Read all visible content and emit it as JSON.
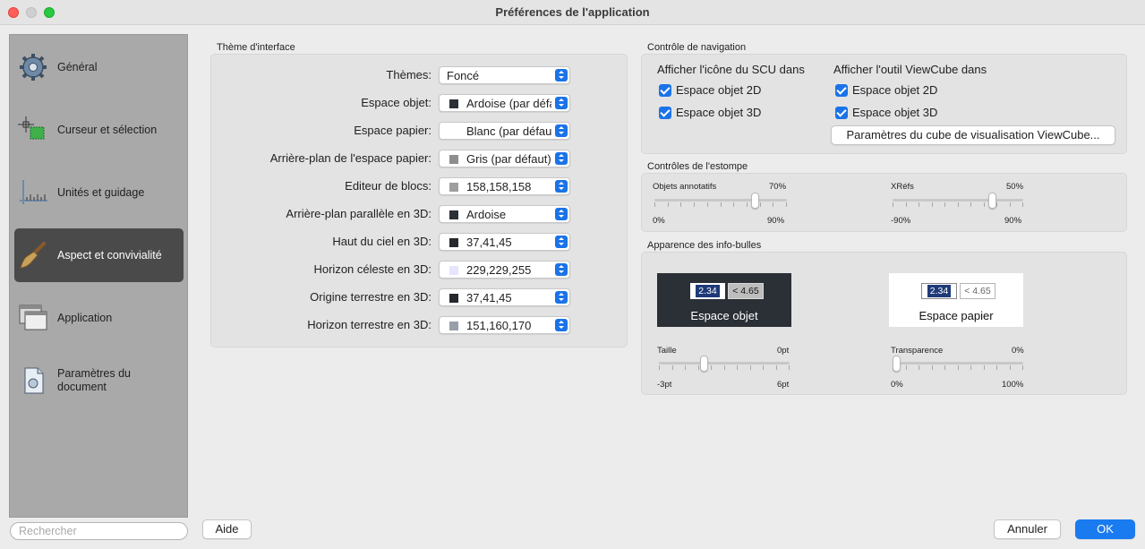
{
  "window": {
    "title": "Préférences de l'application"
  },
  "sidebar": {
    "items": [
      {
        "label": "Général",
        "icon": "gear-icon"
      },
      {
        "label": "Curseur et sélection",
        "icon": "crosshair-icon"
      },
      {
        "label": "Unités et guidage",
        "icon": "ruler-icon"
      },
      {
        "label": "Aspect et convivialité",
        "icon": "brush-icon",
        "active": true
      },
      {
        "label": "Application",
        "icon": "windows-icon"
      },
      {
        "label": "Paramètres du document",
        "icon": "document-icon"
      }
    ],
    "search_placeholder": "Rechercher"
  },
  "theme": {
    "group_title": "Thème d'interface",
    "rows": [
      {
        "label": "Thèmes:",
        "value": "Foncé",
        "swatch": ""
      },
      {
        "label": "Espace objet:",
        "value": "Ardoise (par défaut)",
        "swatch": "#2b2f36"
      },
      {
        "label": "Espace papier:",
        "value": "Blanc (par défaut)",
        "swatch": "#ffffff"
      },
      {
        "label": "Arrière-plan de l'espace papier:",
        "value": "Gris (par défaut)",
        "swatch": "#8e8e8e"
      },
      {
        "label": "Editeur de blocs:",
        "value": "158,158,158",
        "swatch": "#9e9e9e"
      },
      {
        "label": "Arrière-plan parallèle en 3D:",
        "value": "Ardoise",
        "swatch": "#2b2f36"
      },
      {
        "label": "Haut du ciel en 3D:",
        "value": "37,41,45",
        "swatch": "#25292d"
      },
      {
        "label": "Horizon céleste en 3D:",
        "value": "229,229,255",
        "swatch": "#e5e5ff"
      },
      {
        "label": "Origine terrestre en 3D:",
        "value": "37,41,45",
        "swatch": "#25292d"
      },
      {
        "label": "Horizon terrestre en 3D:",
        "value": "151,160,170",
        "swatch": "#97a0aa"
      }
    ]
  },
  "navigation": {
    "group_title": "Contrôle de navigation",
    "scu_heading": "Afficher l'icône du SCU dans",
    "viewcube_heading": "Afficher l'outil ViewCube dans",
    "scu_checks": [
      {
        "label": "Espace objet 2D",
        "checked": true
      },
      {
        "label": "Espace objet 3D",
        "checked": true
      }
    ],
    "viewcube_checks": [
      {
        "label": "Espace objet 2D",
        "checked": true
      },
      {
        "label": "Espace objet 3D",
        "checked": true
      }
    ],
    "viewcube_button": "Paramètres du cube de visualisation ViewCube..."
  },
  "fade": {
    "group_title": "Contrôles de l'estompe",
    "annot": {
      "label": "Objets annotatifs",
      "value_text": "70%",
      "min": "0%",
      "max": "90%",
      "fraction": 0.778
    },
    "xref": {
      "label": "XRéfs",
      "value_text": "50%",
      "min": "-90%",
      "max": "90%",
      "fraction": 0.778
    }
  },
  "tooltips": {
    "group_title": "Apparence des info-bulles",
    "model_preview": {
      "caption": "Espace objet",
      "value1": "2.34",
      "value2": "< 4.65"
    },
    "paper_preview": {
      "caption": "Espace papier",
      "value1": "2.34",
      "value2": "< 4.65"
    },
    "size": {
      "label": "Taille",
      "value_text": "0pt",
      "min": "-3pt",
      "max": "6pt",
      "fraction": 0.333
    },
    "transparency": {
      "label": "Transparence",
      "value_text": "0%",
      "min": "0%",
      "max": "100%",
      "fraction": 0.0
    }
  },
  "footer": {
    "help": "Aide",
    "cancel": "Annuler",
    "ok": "OK"
  },
  "colors": {
    "accent": "#1a73e8",
    "sidebar_bg": "#a9a9a9",
    "sidebar_active": "#4a4a4a",
    "preview_dark": "#2b2f36",
    "tooltip_value_bg": "#1f3a78"
  }
}
